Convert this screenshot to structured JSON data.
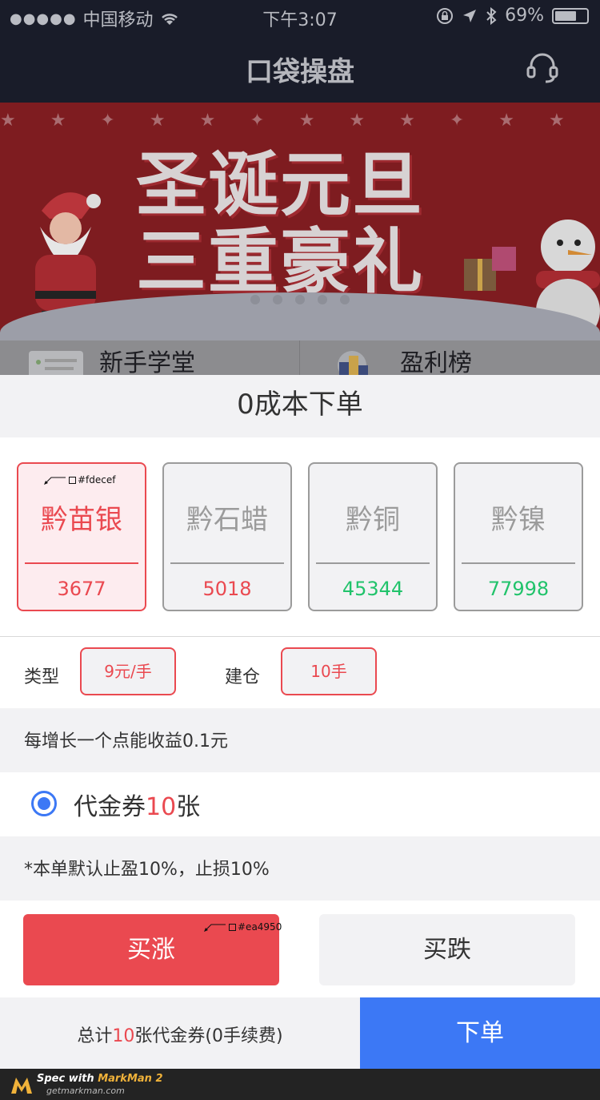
{
  "status_bar": {
    "signal_dots": "●●●●●",
    "carrier": "中国移动",
    "wifi_icon": "wifi-icon",
    "time": "下午3:07",
    "battery_percent": "69%",
    "battery_level": 0.69
  },
  "nav": {
    "title": "口袋操盘",
    "support_icon": "headset-icon"
  },
  "banner": {
    "headline_line1": "圣诞元旦",
    "headline_line2": "三重豪礼",
    "page_count": 5,
    "current_page": 1
  },
  "quick_links": [
    {
      "label": "新手学堂",
      "icon": "classroom-icon"
    },
    {
      "label": "盈利榜",
      "icon": "podium-icon"
    }
  ],
  "sheet": {
    "title": "0成本下单",
    "products": [
      {
        "name": "黔苗银",
        "price": "3677",
        "active": true,
        "price_color": "#ea4950"
      },
      {
        "name": "黔石蜡",
        "price": "5018",
        "active": false,
        "price_color": "#ea4950"
      },
      {
        "name": "黔铜",
        "price": "45344",
        "active": false,
        "price_color": "#21c36b"
      },
      {
        "name": "黔镍",
        "price": "77998",
        "active": false,
        "price_color": "#21c36b"
      }
    ],
    "type_label": "类型",
    "type_value": "9元/手",
    "position_label": "建仓",
    "position_value": "10手",
    "gain_info": "每增长一个点能收益0.1元",
    "voucher_prefix": "代金券",
    "voucher_count": "10",
    "voucher_suffix": "张",
    "voucher_selected": true,
    "stop_info": "*本单默认止盈10%，止损10%",
    "buy_up": "买涨",
    "buy_down": "买跌",
    "summary_prefix": "总计",
    "summary_count": "10",
    "summary_suffix": "张代金券(0手续费)",
    "submit": "下单"
  },
  "annotations": {
    "card_color": "#fdecef",
    "button_color": "#ea4950"
  },
  "watermark": {
    "spec_with": "Spec with ",
    "brand": "MarkMan 2",
    "site": "getmarkman.com"
  },
  "colors": {
    "accent_red": "#ea4950",
    "accent_blue": "#3c78f5",
    "price_green": "#21c36b",
    "nav_bg": "#191c29"
  }
}
